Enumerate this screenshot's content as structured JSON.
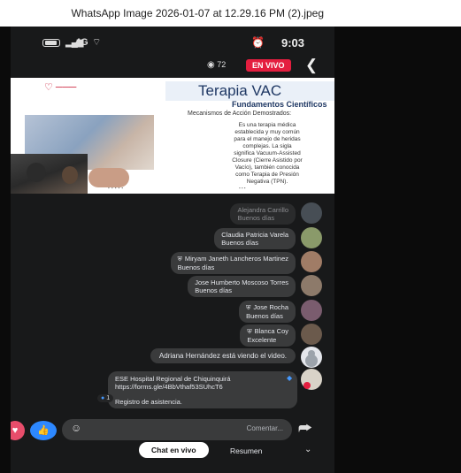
{
  "window": {
    "title": "WhatsApp Image 2026-01-07 at 12.29.16 PM (2).jpeg"
  },
  "status_bar": {
    "time": "9:03",
    "network": "4G"
  },
  "live": {
    "badge": "EN VIVO",
    "viewers": "72"
  },
  "slide": {
    "title": "Terapia VAC",
    "subtitle": "Fundamentos Científicos",
    "mechanisms": "Mecanismos de Acción Demostrados:",
    "body": "Es una terapia médica establecida y muy común para el manejo de heridas complejas. La sigla significa Vacuum-Assisted Closure (Cierre Asistido por Vacío), también conocida como Terapia de Presión Negativa (TPN)."
  },
  "comments": [
    {
      "name": "Alejandra Carrillo",
      "message": "Buenos días",
      "avatar_color": "#6f7b86"
    },
    {
      "name": "Claudia Patricia Varela",
      "message": "Buenos días",
      "avatar_color": "#8a9a6a"
    },
    {
      "name": "Miryam Janeth Lancheros Martinez",
      "message": "Buenos días",
      "avatar_color": "#a07c66",
      "badge_icon": "shield-icon"
    },
    {
      "name": "Jose Humberto Moscoso Torres",
      "message": "Buenos días",
      "avatar_color": "#8d7a6a"
    },
    {
      "name": "Jose Rocha",
      "message": "Buenos días",
      "avatar_color": "#7a5c6e",
      "badge_icon": "shield-icon"
    },
    {
      "name": "Blanca Coy",
      "message": "Excelente",
      "avatar_color": "#6b5a4c",
      "badge_icon": "shield-icon"
    }
  ],
  "joined": {
    "text": "Adriana Hernández está viendo el video."
  },
  "pinned": {
    "organization": "ESE Hospital Regional de Chiquinquirá",
    "link": "https://forms.gle/4BbVthaf53SUhcT6",
    "registration": "Registro de asistencia.",
    "like_count": "1"
  },
  "composer": {
    "placeholder": "Comentar..."
  },
  "footer": {
    "chat_tab": "Chat en vivo",
    "summary_tab": "Resumen"
  },
  "colors": {
    "live_red": "#e41e3f",
    "like_blue": "#2d88ff",
    "bubble": "#3a3b3c",
    "background": "#18191a"
  }
}
